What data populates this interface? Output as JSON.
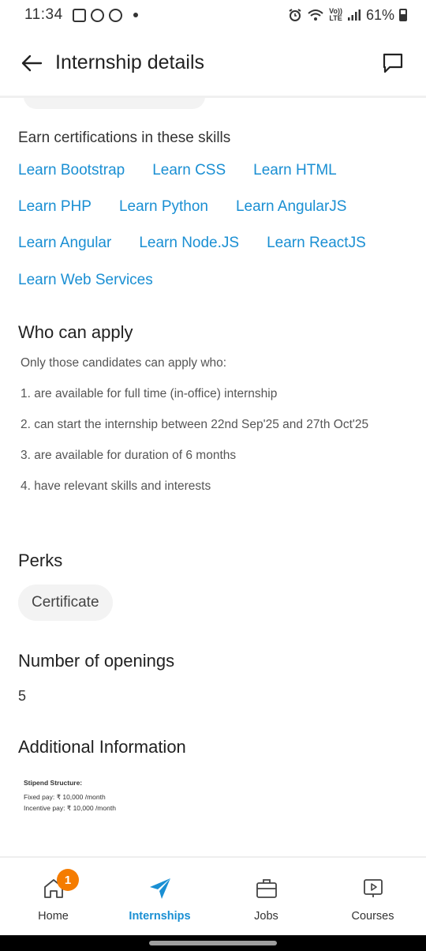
{
  "status_bar": {
    "time": "11:34",
    "volte_top": "Vo))",
    "volte_bottom": "LTE",
    "battery": "61%"
  },
  "app_bar": {
    "title": "Internship details",
    "back_icon": "back-arrow-icon",
    "chat_icon": "chat-icon"
  },
  "skills": {
    "heading": "Earn certifications in these skills",
    "rows": [
      [
        "Learn Bootstrap",
        "Learn CSS",
        "Learn HTML"
      ],
      [
        "Learn PHP",
        "Learn Python",
        "Learn AngularJS"
      ],
      [
        "Learn Angular",
        "Learn Node.JS",
        "Learn ReactJS"
      ],
      [
        "Learn Web Services"
      ]
    ],
    "link_color": "#1a8fd3"
  },
  "who_can_apply": {
    "title": "Who can apply",
    "intro": "Only those candidates can apply who:",
    "items": [
      "1. are available for full time (in-office) internship",
      "2. can start the internship between 22nd Sep'25 and 27th Oct'25",
      "3. are available for duration of 6 months",
      "4. have relevant skills and interests"
    ]
  },
  "perks": {
    "title": "Perks",
    "items": [
      "Certificate"
    ]
  },
  "openings": {
    "title": "Number of openings",
    "value": "5"
  },
  "additional": {
    "title": "Additional Information",
    "stipend_heading": "Stipend Structure:",
    "fixed_pay": "Fixed pay: ₹ 10,000 /month",
    "incentive_pay": "Incentive pay: ₹ 10,000 /month"
  },
  "bottom_nav": {
    "items": [
      {
        "label": "Home",
        "icon": "home-icon",
        "active": false
      },
      {
        "label": "Internships",
        "icon": "paper-plane-icon",
        "active": true
      },
      {
        "label": "Jobs",
        "icon": "briefcase-icon",
        "active": false
      },
      {
        "label": "Courses",
        "icon": "play-screen-icon",
        "active": false
      }
    ],
    "home_badge": "1",
    "badge_color": "#f57c00",
    "active_color": "#1a8fd3"
  }
}
